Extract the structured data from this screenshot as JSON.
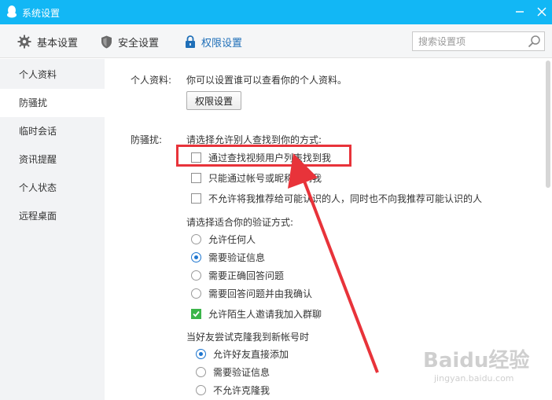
{
  "window": {
    "title": "系统设置",
    "colors": {
      "titlebar": "#12b7f5",
      "accent": "#1f6fb8",
      "highlight": "#e8333a"
    }
  },
  "tabs": [
    {
      "label": "基本设置",
      "icon": "gear-icon"
    },
    {
      "label": "安全设置",
      "icon": "shield-icon"
    },
    {
      "label": "权限设置",
      "icon": "lock-icon",
      "active": true
    }
  ],
  "search": {
    "placeholder": "搜索设置项",
    "value": ""
  },
  "sidebar": {
    "items": [
      {
        "label": "个人资料"
      },
      {
        "label": "防骚扰",
        "active": true
      },
      {
        "label": "临时会话"
      },
      {
        "label": "资讯提醒"
      },
      {
        "label": "个人状态"
      },
      {
        "label": "远程桌面"
      }
    ]
  },
  "profile": {
    "label": "个人资料:",
    "description": "你可以设置谁可以查看你的个人资料。",
    "button": "权限设置"
  },
  "antiharass": {
    "label": "防骚扰:",
    "find_heading": "请选择允许别人查找到你的方式:",
    "find_options": [
      {
        "label": "通过查找视频用户列表找到我",
        "checked": false
      },
      {
        "label": "只能通过帐号或昵称找到我",
        "checked": false
      },
      {
        "label": "不允许将我推荐给可能认识的人，同时也不向我推荐可能认识的人",
        "checked": false
      }
    ],
    "verify_heading": "请选择适合你的验证方式:",
    "verify_options": [
      {
        "label": "允许任何人",
        "checked": false
      },
      {
        "label": "需要验证信息",
        "checked": true
      },
      {
        "label": "需要正确回答问题",
        "checked": false
      },
      {
        "label": "需要回答问题并由我确认",
        "checked": false
      }
    ],
    "group_invite": {
      "label": "允许陌生人邀请我加入群聊",
      "checked": true
    },
    "clone_heading": "当好友尝试克隆我到新帐号时",
    "clone_options": [
      {
        "label": "允许好友直接添加",
        "checked": true
      },
      {
        "label": "需要验证信息",
        "checked": false
      },
      {
        "label": "不允许克隆我",
        "checked": false
      }
    ]
  },
  "watermark": {
    "text": "Baidu经验",
    "sub": "jingyan.baidu.com"
  }
}
